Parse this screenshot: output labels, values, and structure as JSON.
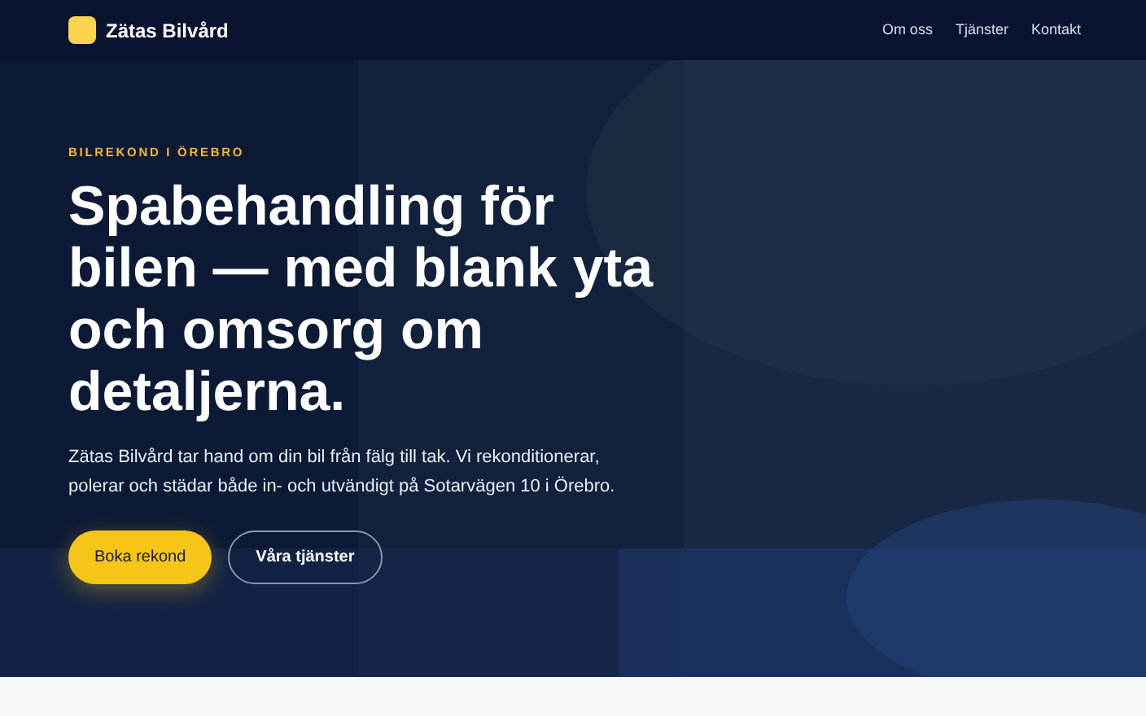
{
  "header": {
    "logo_text": "Zätas Bilvård",
    "nav": [
      {
        "label": "Om oss"
      },
      {
        "label": "Tjänster"
      },
      {
        "label": "Kontakt"
      }
    ]
  },
  "hero": {
    "eyebrow": "BILREKOND I ÖREBRO",
    "title": "Spabehandling för bilen — med blank yta och omsorg om detaljerna.",
    "lead": "Zätas Bilvård tar hand om din bil från fälg till tak. Vi rekonditionerar, polerar och städar både in- och utvändigt på Sotarvägen 10 i Örebro.",
    "buttons": [
      {
        "label": "Boka rekond",
        "kind": "primary"
      },
      {
        "label": "Våra tjänster",
        "kind": "outline"
      }
    ]
  }
}
